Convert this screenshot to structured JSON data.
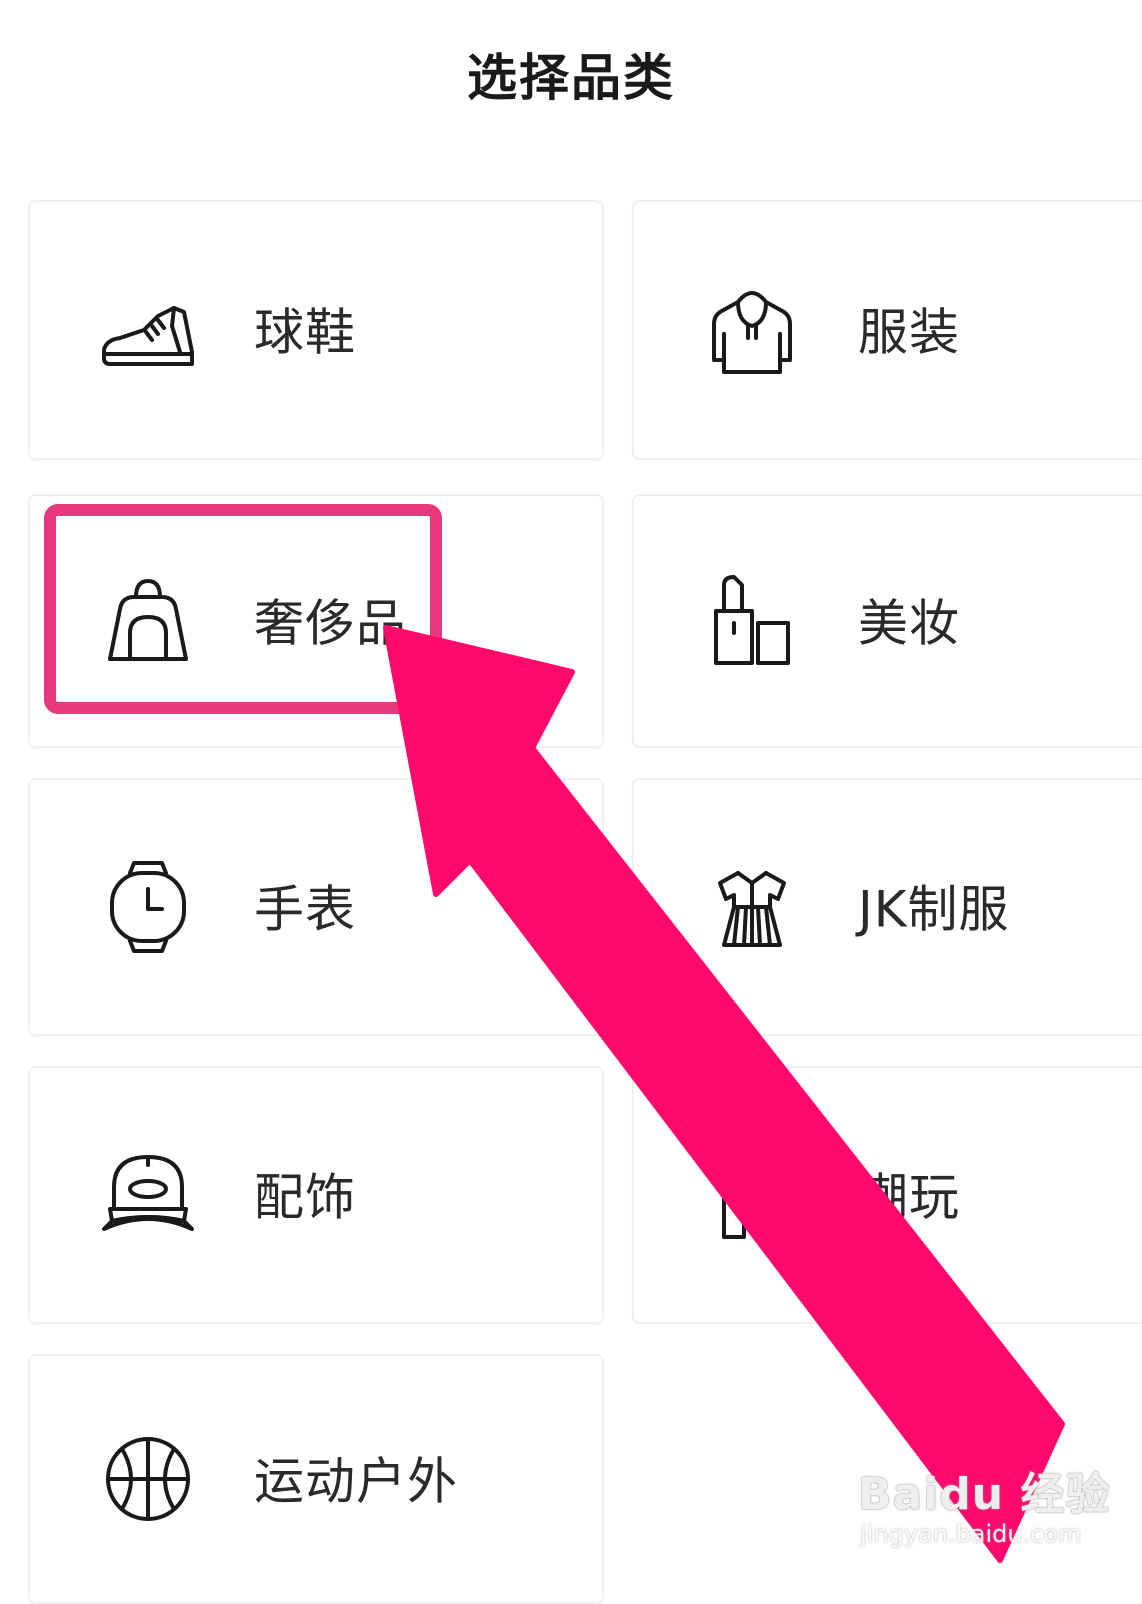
{
  "header": {
    "title": "选择品类"
  },
  "categories": [
    {
      "label": "球鞋",
      "icon": "sneaker-icon"
    },
    {
      "label": "服装",
      "icon": "hoodie-icon"
    },
    {
      "label": "奢侈品",
      "icon": "handbag-icon"
    },
    {
      "label": "美妆",
      "icon": "lipstick-icon"
    },
    {
      "label": "手表",
      "icon": "watch-icon"
    },
    {
      "label": "JK制服",
      "icon": "jk-dress-icon"
    },
    {
      "label": "配饰",
      "icon": "cap-icon"
    },
    {
      "label": "潮玩",
      "icon": "toy-figure-icon"
    },
    {
      "label": "运动户外",
      "icon": "basketball-icon"
    }
  ],
  "annotation": {
    "highlight_color": "#e8387d",
    "arrow_color": "#ff0a6c"
  },
  "watermark": {
    "logo": "Baidu 经验",
    "url": "jingyan.baidu.com"
  }
}
